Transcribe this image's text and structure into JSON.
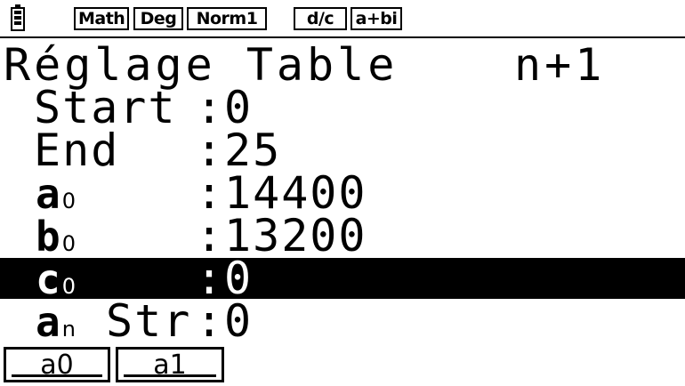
{
  "status": {
    "modes": [
      "Math",
      "Deg",
      "Norm1"
    ],
    "modes2": [
      "d/c",
      "a+bi"
    ]
  },
  "title": {
    "label": "Réglage Table",
    "recurrence": "n+1"
  },
  "rows": [
    {
      "label": "Start",
      "colon": ":",
      "value": "0"
    },
    {
      "label": "End",
      "colon": ":",
      "value": "25"
    },
    {
      "var": "a",
      "sub": "0",
      "colon": ":",
      "value": "14400"
    },
    {
      "var": "b",
      "sub": "0",
      "colon": ":",
      "value": "13200"
    },
    {
      "var": "c",
      "sub": "0",
      "colon": ":",
      "value": "0"
    },
    {
      "var": "a",
      "sub": "n",
      "suffix": "Str",
      "colon": ":",
      "value": "0"
    }
  ],
  "fkeys": [
    "a0",
    "a1"
  ],
  "colors": {
    "background": "#ffffff",
    "foreground": "#000000",
    "highlight": "#000000"
  }
}
